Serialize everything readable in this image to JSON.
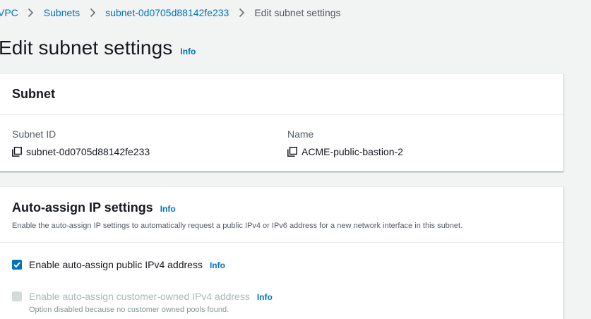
{
  "breadcrumb": {
    "items": [
      "VPC",
      "Subnets",
      "subnet-0d0705d88142fe233"
    ],
    "current": "Edit subnet settings"
  },
  "page": {
    "title": "Edit subnet settings",
    "info": "Info"
  },
  "subnet_panel": {
    "title": "Subnet",
    "subnet_id_label": "Subnet ID",
    "subnet_id_value": "subnet-0d0705d88142fe233",
    "name_label": "Name",
    "name_value": "ACME-public-bastion-2"
  },
  "auto_assign_panel": {
    "title": "Auto-assign IP settings",
    "info": "Info",
    "description": "Enable the auto-assign IP settings to automatically request a public IPv4 or IPv6 address for a new network interface in this subnet.",
    "options": [
      {
        "label": "Enable auto-assign public IPv4 address",
        "info": "Info",
        "checked": true,
        "disabled": false,
        "help": ""
      },
      {
        "label": "Enable auto-assign customer-owned IPv4 address",
        "info": "Info",
        "checked": false,
        "disabled": true,
        "help": "Option disabled because no customer owned pools found."
      }
    ]
  },
  "icons": {
    "breadcrumb_separator": "chevron-right-icon",
    "copy": "copy-icon",
    "check": "checkmark-icon"
  },
  "colors": {
    "link": "#0073bb",
    "checkbox_checked": "#0073bb",
    "checkbox_disabled": "#d5dbdb",
    "background": "#f2f3f3"
  }
}
